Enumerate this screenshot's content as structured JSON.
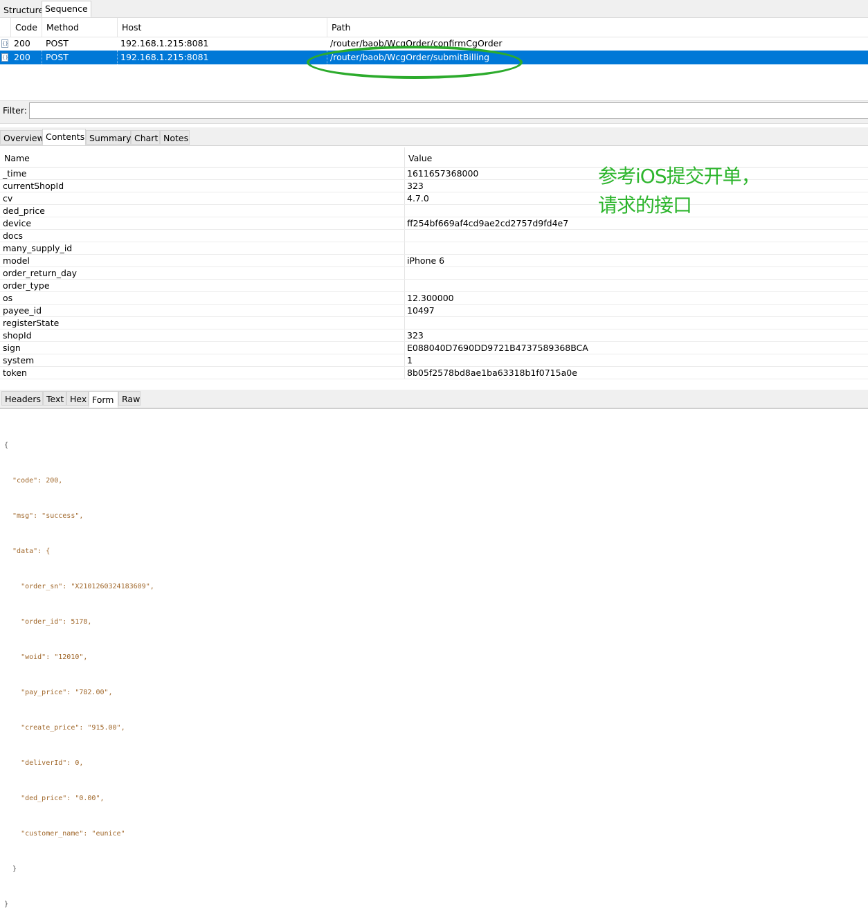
{
  "top_tabs": [
    "Structure",
    "Sequence"
  ],
  "sequence": {
    "columns": [
      "Code",
      "Method",
      "Host",
      "Path"
    ],
    "rows": [
      {
        "icon": "{}",
        "code": "200",
        "method": "POST",
        "host": "192.168.1.215:8081",
        "path": "/router/baob/WcgOrder/confirmCgOrder",
        "selected": false
      },
      {
        "icon": "{}",
        "code": "200",
        "method": "POST",
        "host": "192.168.1.215:8081",
        "path": "/router/baob/WcgOrder/submitBilling",
        "selected": true
      }
    ]
  },
  "filter": {
    "label": "Filter:",
    "value": ""
  },
  "inspector_tabs": [
    "Overview",
    "Contents",
    "Summary",
    "Chart",
    "Notes"
  ],
  "contents": {
    "columns": [
      "Name",
      "Value"
    ],
    "rows": [
      {
        "name": "_time",
        "value": "1611657368000"
      },
      {
        "name": "currentShopId",
        "value": "323"
      },
      {
        "name": "cv",
        "value": "4.7.0"
      },
      {
        "name": "ded_price",
        "value": ""
      },
      {
        "name": "device",
        "value": "ff254bf669af4cd9ae2cd2757d9fd4e7"
      },
      {
        "name": "docs",
        "value": ""
      },
      {
        "name": "many_supply_id",
        "value": ""
      },
      {
        "name": "model",
        "value": "iPhone 6"
      },
      {
        "name": "order_return_day",
        "value": ""
      },
      {
        "name": "order_type",
        "value": ""
      },
      {
        "name": "os",
        "value": "12.300000"
      },
      {
        "name": "payee_id",
        "value": "10497"
      },
      {
        "name": "registerState",
        "value": ""
      },
      {
        "name": "shopId",
        "value": "323"
      },
      {
        "name": "sign",
        "value": "E088040D7690DD9721B4737589368BCA"
      },
      {
        "name": "system",
        "value": "1"
      },
      {
        "name": "token",
        "value": "8b05f2578bd8ae1ba63318b1f0715a0e"
      }
    ]
  },
  "annotation": {
    "line1": "参考iOS提交开单，",
    "line2": "请求的接口",
    "color": "#2db52d"
  },
  "bottom_tabs": [
    "Headers",
    "Text",
    "Hex",
    "Form",
    "Raw"
  ],
  "response_json": [
    "{",
    "  \"code\": 200,",
    "  \"msg\": \"success\",",
    "  \"data\": {",
    "    \"order_sn\": \"X2101260324183609\",",
    "    \"order_id\": 5178,",
    "    \"woid\": \"12010\",",
    "    \"pay_price\": \"782.00\",",
    "    \"create_price\": \"915.00\",",
    "    \"deliverId\": 0,",
    "    \"ded_price\": \"0.00\",",
    "    \"customer_name\": \"eunice\"",
    "  }",
    "}"
  ]
}
